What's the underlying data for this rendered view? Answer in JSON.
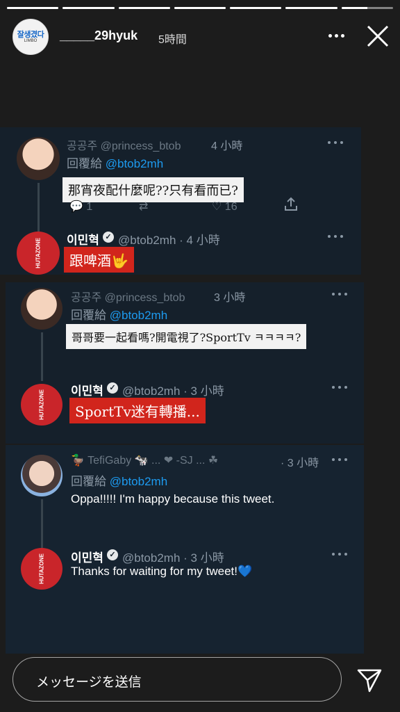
{
  "story": {
    "progress_segments": [
      1,
      1,
      1,
      1,
      1,
      1,
      0.5
    ],
    "username": "_____29hyuk",
    "time": "5時間",
    "avatar_text": "잘생겼다",
    "avatar_subtext": "LIMBO"
  },
  "tweets": [
    {
      "author_name": "공공주 @princess_btob",
      "time": "4 小時",
      "reply_prefix": "回覆給",
      "reply_handle": "@btob2mh",
      "text": "那宵夜配什麼呢??只有看而已?",
      "like_count": "16",
      "reply_count": "1"
    },
    {
      "author_name": "이민혁",
      "handle": "@btob2mh · 4 小時",
      "text": "跟啤酒🤟",
      "avatar_text": "HUTAZONE"
    },
    {
      "author_name": "공공주 @princess_btob",
      "time": "3 小時",
      "reply_prefix": "回覆給",
      "reply_handle": "@btob2mh",
      "text": "哥哥要一起看嗎?開電視了?SportTv ㅋㅋㅋㅋ?"
    },
    {
      "author_name": "이민혁",
      "handle": "@btob2mh · 3 小時",
      "text": "SportTv迷有轉播...",
      "avatar_text": "HUTAZONE"
    },
    {
      "author_name": "🦆 TefiGaby 🐄 ... ❤ -SJ ... ☘",
      "time": "· 3 小時",
      "reply_prefix": "回覆給",
      "reply_handle": "@btob2mh",
      "text": "Oppa!!!!! I'm happy because this tweet."
    },
    {
      "author_name": "이민혁",
      "handle": "@btob2mh · 3 小時",
      "text": "Thanks for waiting for my tweet!💙",
      "avatar_text": "HUTAZONE"
    }
  ],
  "footer": {
    "message_placeholder": "メッセージを送信"
  },
  "icons": [
    "more-icon",
    "close-icon",
    "send-icon",
    "verified-icon",
    "reply-icon",
    "retweet-icon",
    "like-icon",
    "share-icon"
  ]
}
